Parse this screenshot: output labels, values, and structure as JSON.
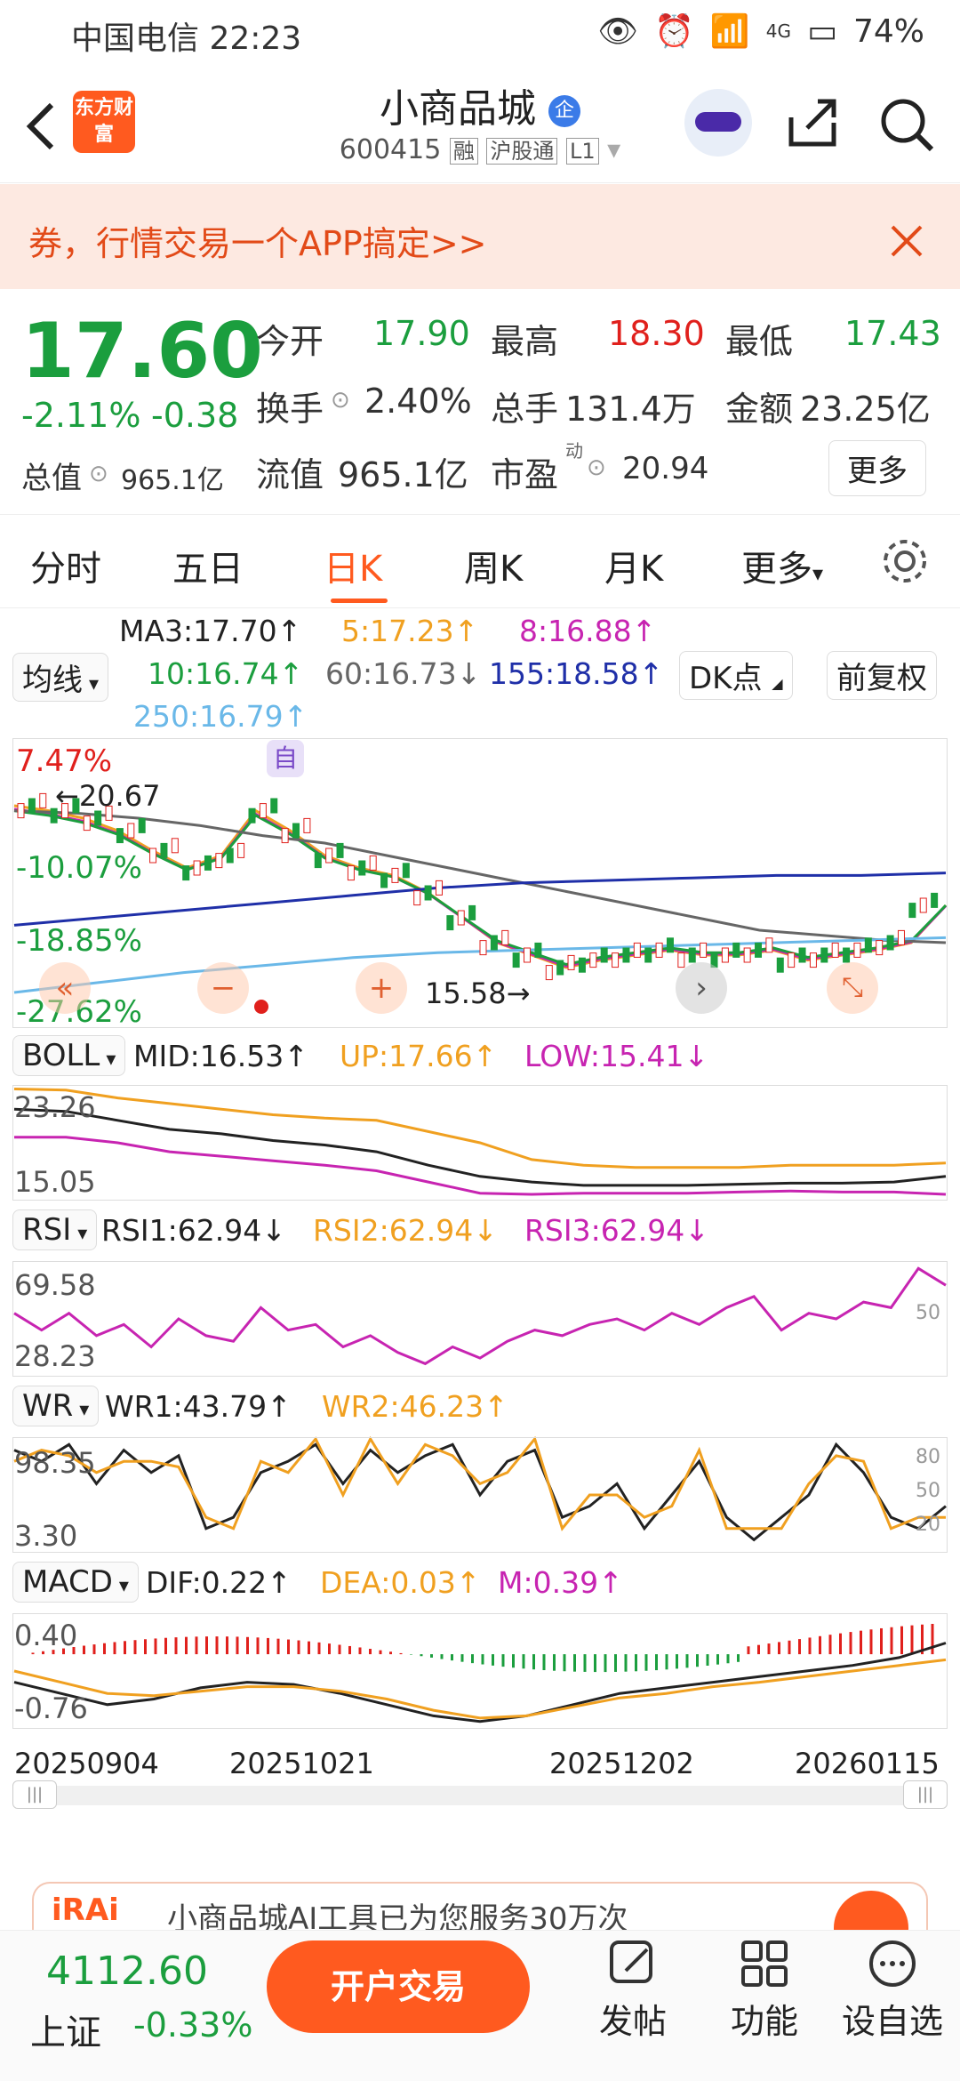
{
  "status": {
    "carrier_time": "中国电信 22:23",
    "network": "4G",
    "battery": "74%"
  },
  "header": {
    "app_logo": "东方财富",
    "title": "小商品城",
    "badge": "企",
    "code": "600415",
    "tags": [
      "融",
      "沪股通",
      "L1"
    ]
  },
  "banner": {
    "text": "券，行情交易一个APP搞定>>"
  },
  "quote": {
    "price": "17.60",
    "change_pct": "-2.11%",
    "change": "-0.38",
    "open_label": "今开",
    "open": "17.90",
    "high_label": "最高",
    "high": "18.30",
    "low_label": "最低",
    "low": "17.43",
    "turnover_label": "换手",
    "turnover": "2.40%",
    "volume_label": "总手",
    "volume": "131.4万",
    "amount_label": "金额",
    "amount": "23.25亿",
    "mktcap_label": "总值",
    "mktcap": "965.1亿",
    "float_label": "流值",
    "float": "965.1亿",
    "pe_label": "市盈",
    "pe_sup": "动",
    "pe": "20.94",
    "more_button": "更多"
  },
  "tabs": [
    "分时",
    "五日",
    "日K",
    "周K",
    "月K",
    "更多"
  ],
  "active_tab": "日K",
  "ma": {
    "selector": "均线",
    "ma3": "MA3:17.70↑",
    "ma5": "5:17.23↑",
    "ma8": "8:16.88↑",
    "ma10": "10:16.74↑",
    "ma60": "60:16.73↓",
    "ma155": "155:18.58↑",
    "ma250": "250:16.79↑",
    "dk_button": "DK点",
    "adjust_button": "前复权"
  },
  "main_chart": {
    "pct_labels": [
      "7.47%",
      "-10.07%",
      "-18.85%",
      "-27.62%"
    ],
    "price_labels": [
      "20.67",
      "15.58"
    ],
    "marker": "自"
  },
  "boll": {
    "selector": "BOLL",
    "mid": "MID:16.53↑",
    "up": "UP:17.66↑",
    "low": "LOW:15.41↓",
    "ticks": [
      "23.26",
      "15.05"
    ]
  },
  "rsi": {
    "selector": "RSI",
    "rsi1": "RSI1:62.94↓",
    "rsi2": "RSI2:62.94↓",
    "rsi3": "RSI3:62.94↓",
    "ticks": [
      "69.58",
      "28.23"
    ],
    "ref": "50"
  },
  "wr": {
    "selector": "WR",
    "wr1": "WR1:43.79↑",
    "wr2": "WR2:46.23↑",
    "ticks": [
      "98.35",
      "3.30"
    ],
    "refs": [
      "80",
      "50",
      "20"
    ]
  },
  "macd": {
    "selector": "MACD",
    "dif": "DIF:0.22↑",
    "dea": "DEA:0.03↑",
    "m": "M:0.39↑",
    "ticks": [
      "0.40",
      "-0.76"
    ]
  },
  "dates": [
    "20250904",
    "20251021",
    "20251202",
    "20260115"
  ],
  "ai_banner": {
    "text": "小商品城AI工具已为您服务30万次"
  },
  "bottom": {
    "index_value": "4112.60",
    "index_name": "上证",
    "index_change": "-0.33%",
    "trade_button": "开户交易",
    "post_label": "发帖",
    "func_label": "功能",
    "watch_label": "设自选"
  },
  "colors": {
    "up": "#e0201c",
    "down": "#1b9e3e",
    "accent": "#ff5a1f",
    "ma5": "#f0a020",
    "ma8": "#c724b1",
    "ma155": "#1f2fa8",
    "ma250": "#6ab8e8",
    "ma60": "#666666"
  }
}
